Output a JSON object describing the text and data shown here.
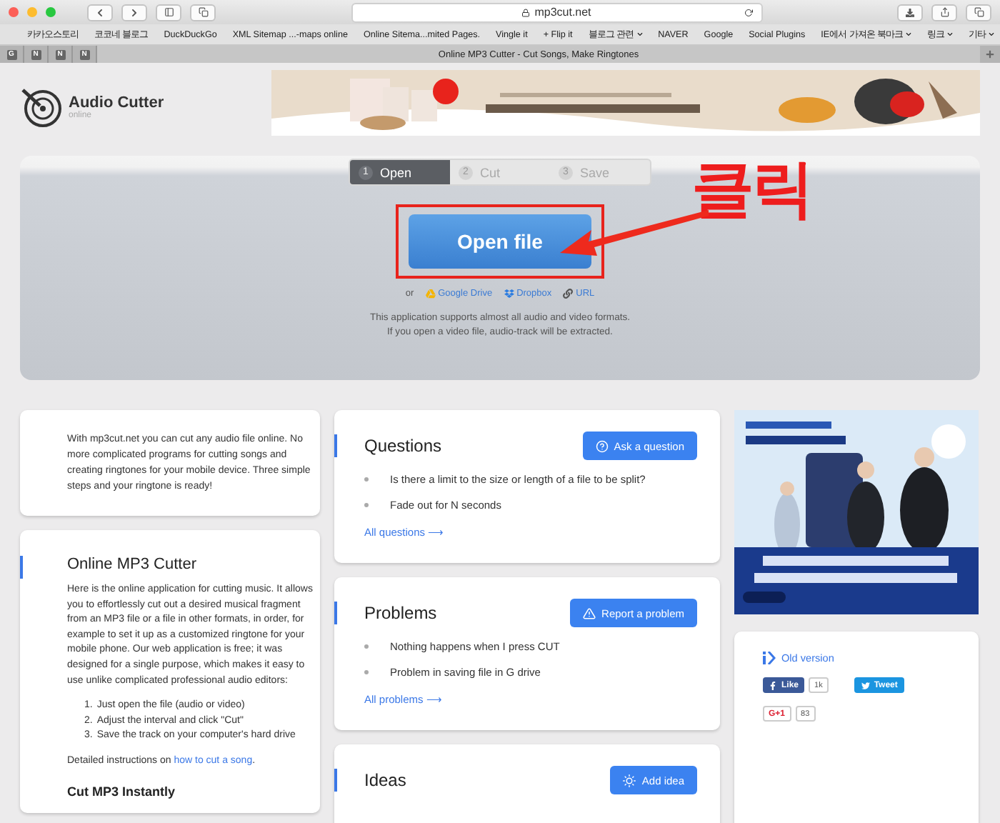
{
  "browser": {
    "url": "mp3cut.net",
    "bookmarks": [
      {
        "label": "카카오스토리",
        "kind": "link"
      },
      {
        "label": "코코네 블로그",
        "kind": "link"
      },
      {
        "label": "DuckDuckGo",
        "kind": "link"
      },
      {
        "label": "XML Sitemap ...-maps online",
        "kind": "link"
      },
      {
        "label": "Online Sitema...mited Pages.",
        "kind": "link"
      },
      {
        "label": "Vingle it",
        "kind": "link"
      },
      {
        "label": "+ Flip it",
        "kind": "link"
      },
      {
        "label": "블로그 관련",
        "kind": "folder"
      },
      {
        "label": "NAVER",
        "kind": "link"
      },
      {
        "label": "Google",
        "kind": "link"
      },
      {
        "label": "Social Plugins",
        "kind": "link"
      },
      {
        "label": "IE에서 가져온 북마크",
        "kind": "folder"
      },
      {
        "label": "링크",
        "kind": "folder"
      },
      {
        "label": "기타",
        "kind": "folder"
      }
    ],
    "pinned_tabs": [
      "G",
      "N",
      "N",
      "N"
    ],
    "tab_title": "Online MP3 Cutter - Cut Songs, Make Ringtones"
  },
  "site": {
    "logo": {
      "title": "Audio Cutter",
      "subtitle": "online"
    },
    "steps": [
      {
        "number": "1",
        "label": "Open",
        "selected": true
      },
      {
        "number": "2",
        "label": "Cut",
        "selected": false
      },
      {
        "number": "3",
        "label": "Save",
        "selected": false
      }
    ],
    "open_button": "Open file",
    "annotation": "클릭",
    "or": "or",
    "sources": [
      {
        "label": "Google Drive",
        "kind": "drive"
      },
      {
        "label": "Dropbox",
        "kind": "dropbox"
      },
      {
        "label": "URL",
        "kind": "url"
      }
    ],
    "note": [
      "This application supports almost all audio and video formats.",
      "If you open a video file, audio-track will be extracted."
    ]
  },
  "intro": "With mp3cut.net you can cut any audio file online. No more complicated programs for cutting songs and creating ringtones for your mobile device. Three simple steps and your ringtone is ready!",
  "article": {
    "title": "Online MP3 Cutter",
    "body": "Here is the online application for cutting music. It allows you to effortlessly cut out a desired musical fragment from an MP3 file or a file in other formats, in order, for example to set it up as a customized ringtone for your mobile phone. Our web application is free; it was designed for a single purpose, which makes it easy to use unlike complicated professional audio editors:",
    "steps": [
      {
        "number": "1.",
        "text": "Just open the file (audio or video)"
      },
      {
        "number": "2.",
        "text": "Adjust the interval and click \"Cut\""
      },
      {
        "number": "3.",
        "text": "Save the track on your computer's hard drive"
      }
    ],
    "details": {
      "before": "Detailed instructions on ",
      "link": "how to cut a song",
      "after": "."
    },
    "subtitle": "Cut MP3 Instantly"
  },
  "sections": [
    {
      "title": "Questions",
      "button": "Ask a question",
      "kind": "question",
      "items": [
        "Is there a limit to the size or length of a file to be split?",
        "Fade out for N seconds"
      ],
      "more": "All questions ⟶"
    },
    {
      "title": "Problems",
      "button": "Report a problem",
      "kind": "problem",
      "items": [
        "Nothing happens when I press CUT",
        "Problem in saving file in G drive"
      ],
      "more": "All problems ⟶"
    },
    {
      "title": "Ideas",
      "button": "Add idea",
      "kind": "idea"
    }
  ],
  "social": {
    "old_version": "Old version",
    "like": "Like",
    "like_count": "1k",
    "tweet": "Tweet",
    "gplus": "G+1",
    "gplus_count": "83"
  }
}
